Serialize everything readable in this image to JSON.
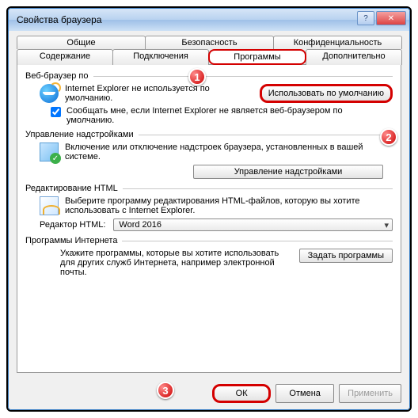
{
  "title": "Свойства браузера",
  "tabs_row1": [
    "Общие",
    "Безопасность",
    "Конфиденциальность"
  ],
  "tabs_row2": [
    "Содержание",
    "Подключения",
    "Программы",
    "Дополнительно"
  ],
  "badges": {
    "b1": "1",
    "b2": "2",
    "b3": "3"
  },
  "browser": {
    "group": "Веб-браузер по",
    "msg": "Internet Explorer не используется по умолчанию.",
    "default_btn": "Использовать по умолчанию",
    "notify": "Сообщать мне, если Internet Explorer не является веб-браузером по умолчанию."
  },
  "addons": {
    "group": "Управление надстройками",
    "msg": "Включение или отключение надстроек браузера, установленных в вашей системе.",
    "btn": "Управление надстройками"
  },
  "html": {
    "group": "Редактирование HTML",
    "msg": "Выберите программу редактирования HTML-файлов, которую вы хотите использовать с Internet Explorer.",
    "label": "Редактор HTML:",
    "value": "Word 2016"
  },
  "progs": {
    "group": "Программы Интернета",
    "msg": "Укажите программы, которые вы хотите использовать для других служб Интернета, например электронной почты.",
    "btn": "Задать программы"
  },
  "dlg": {
    "ok": "ОК",
    "cancel": "Отмена",
    "apply": "Применить"
  }
}
